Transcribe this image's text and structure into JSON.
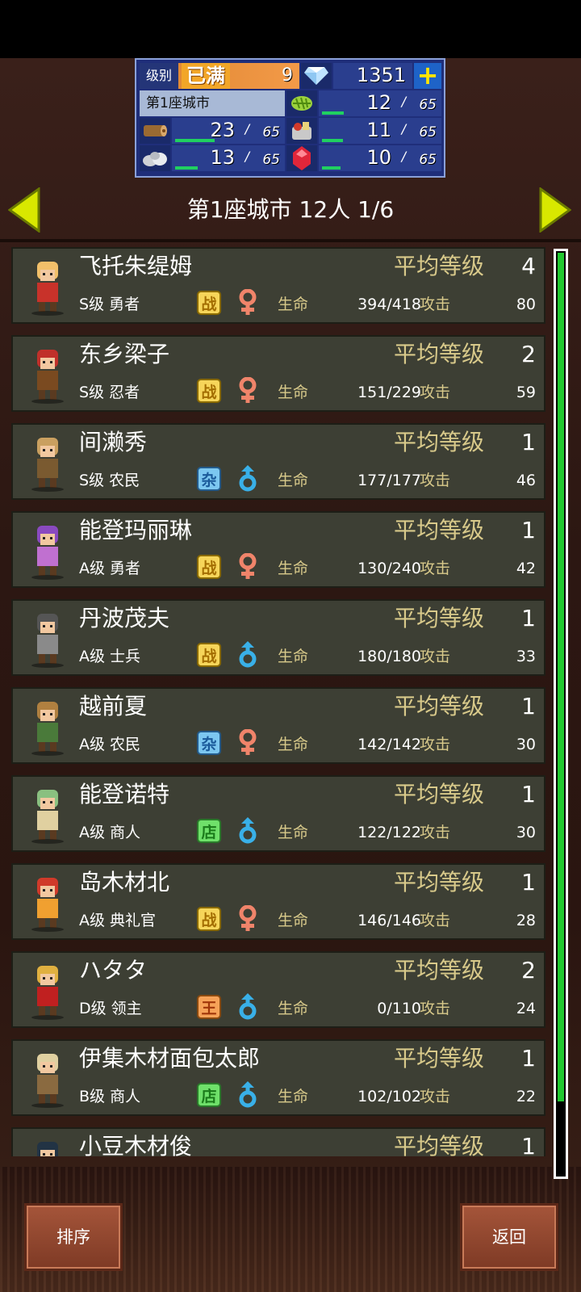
{
  "resources": {
    "rank_label": "级别",
    "rank_max": "已满",
    "rank_value": "9",
    "gems": "1351",
    "city_name": "第1座城市",
    "herb": {
      "value": "12",
      "cap": "65",
      "fill": 0.18
    },
    "wood": {
      "value": "23",
      "cap": "65",
      "fill": 0.35
    },
    "food": {
      "value": "11",
      "cap": "65",
      "fill": 0.17
    },
    "stone": {
      "value": "13",
      "cap": "65",
      "fill": 0.2
    },
    "ruby": {
      "value": "10",
      "cap": "65",
      "fill": 0.15
    },
    "slash": "/"
  },
  "header": {
    "title": "第1座城市  12人 1/6"
  },
  "labels": {
    "avg_level": "平均等级",
    "hp": "生命",
    "atk": "攻击"
  },
  "characters": [
    {
      "name": "飞托朱缇姆",
      "level": "4",
      "rank": "S级 勇者",
      "badge": "战",
      "badge_type": "zhan",
      "gender": "female",
      "hp": "394/418",
      "atk": "80"
    },
    {
      "name": "东乡梁子",
      "level": "2",
      "rank": "S级 忍者",
      "badge": "战",
      "badge_type": "zhan",
      "gender": "female",
      "hp": "151/229",
      "atk": "59"
    },
    {
      "name": "间濑秀",
      "level": "1",
      "rank": "S级 农民",
      "badge": "杂",
      "badge_type": "za",
      "gender": "male",
      "hp": "177/177",
      "atk": "46"
    },
    {
      "name": "能登玛丽琳",
      "level": "1",
      "rank": "A级 勇者",
      "badge": "战",
      "badge_type": "zhan",
      "gender": "female",
      "hp": "130/240",
      "atk": "42"
    },
    {
      "name": "丹波茂夫",
      "level": "1",
      "rank": "A级 士兵",
      "badge": "战",
      "badge_type": "zhan",
      "gender": "male",
      "hp": "180/180",
      "atk": "33"
    },
    {
      "name": "越前夏",
      "level": "1",
      "rank": "A级 农民",
      "badge": "杂",
      "badge_type": "za",
      "gender": "female",
      "hp": "142/142",
      "atk": "30"
    },
    {
      "name": "能登诺特",
      "level": "1",
      "rank": "A级 商人",
      "badge": "店",
      "badge_type": "dian",
      "gender": "male",
      "hp": "122/122",
      "atk": "30"
    },
    {
      "name": "岛木材北",
      "level": "1",
      "rank": "A级 典礼官",
      "badge": "战",
      "badge_type": "zhan",
      "gender": "female",
      "hp": "146/146",
      "atk": "28"
    },
    {
      "name": "ハタタ",
      "level": "2",
      "rank": "D级 领主",
      "badge": "王",
      "badge_type": "wang",
      "gender": "male",
      "hp": "0/110",
      "atk": "24"
    },
    {
      "name": "伊集木材面包太郎",
      "level": "1",
      "rank": "B级 商人",
      "badge": "店",
      "badge_type": "dian",
      "gender": "male",
      "hp": "102/102",
      "atk": "22"
    },
    {
      "name": "小豆木材俊",
      "level": "1",
      "rank": "",
      "badge": "",
      "badge_type": "",
      "gender": "",
      "hp": "",
      "atk": ""
    }
  ],
  "scroll_fraction": 0.92,
  "buttons": {
    "sort": "排序",
    "back": "返回"
  }
}
